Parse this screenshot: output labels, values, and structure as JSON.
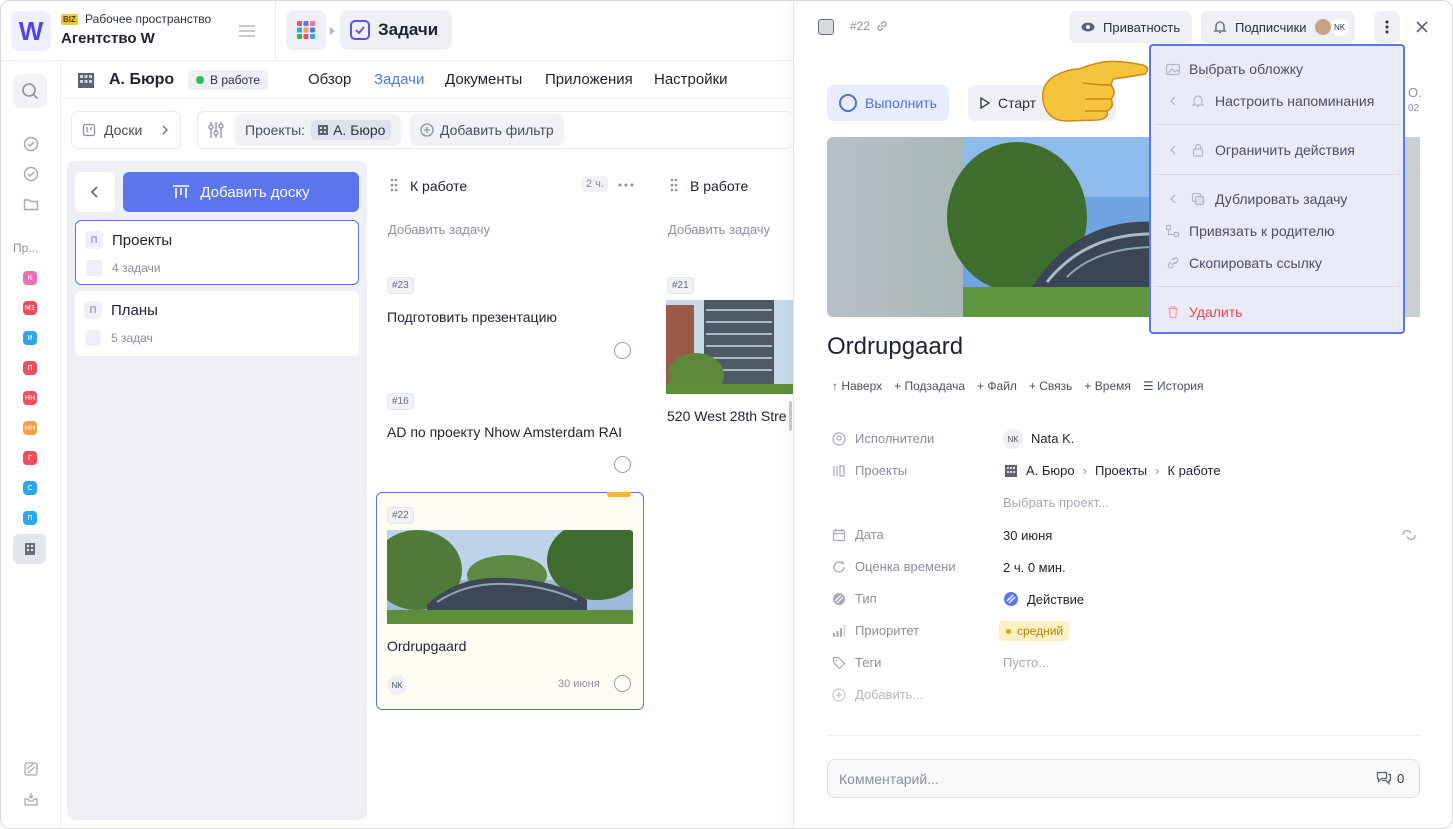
{
  "workspace": {
    "tag": "BIZ",
    "subtitle": "Рабочее пространство",
    "name": "Агентство W",
    "logo_letter": "W"
  },
  "app_tab": {
    "label": "Задачи"
  },
  "rail": {
    "section_label": "Пр...",
    "items": [
      {
        "letter": "К",
        "color": "#f06fb4"
      },
      {
        "letter": "М1",
        "color": "#f04e5e"
      },
      {
        "letter": "И",
        "color": "#2ba7f0"
      },
      {
        "letter": "П",
        "color": "#f04e5e"
      },
      {
        "letter": "НН",
        "color": "#f04e5e"
      },
      {
        "letter": "НН",
        "color": "#f5a144"
      },
      {
        "letter": "Г",
        "color": "#f04e5e"
      },
      {
        "letter": "С",
        "color": "#2ba7f0"
      },
      {
        "letter": "П",
        "color": "#2ba7f0"
      }
    ]
  },
  "project": {
    "title": "А. Бюро",
    "status": "В работе",
    "nav": [
      "Обзор",
      "Задачи",
      "Документы",
      "Приложения",
      "Настройки"
    ],
    "active_nav": "Задачи"
  },
  "filters": {
    "boards_label": "Доски",
    "projects_label": "Проекты:",
    "project_chip": "А. Бюро",
    "add_filter": "Добавить фильтр"
  },
  "boards": {
    "add_label": "Добавить доску",
    "items": [
      {
        "letter": "П",
        "name": "Проекты",
        "count": "4 задачи"
      },
      {
        "letter": "П",
        "name": "Планы",
        "count": "5 задач"
      }
    ]
  },
  "columns": [
    {
      "title": "К работе",
      "badge": "2 ч.",
      "add_task": "Добавить задачу",
      "cards": [
        {
          "num": "#23",
          "title": "Подготовить презентацию"
        },
        {
          "num": "#16",
          "title": "AD по проекту Nhow Amsterdam RAI"
        },
        {
          "num": "#22",
          "title": "Ordrupgaard",
          "assignee": "NK",
          "date": "30 июня"
        }
      ]
    },
    {
      "title": "В работе",
      "add_task": "Добавить задачу",
      "cards": [
        {
          "num": "#21",
          "title": "520 West 28th Stre"
        }
      ]
    }
  ],
  "panel": {
    "task_num": "#22",
    "privacy": "Приватность",
    "subscribers": "Подписчики",
    "subscriber_initials": "NK",
    "complete": "Выполнить",
    "start": "Старт",
    "right_clip_top": "О.",
    "right_clip_bottom": "02",
    "title": "Ordrupgaard",
    "actions": [
      "Наверх",
      "Подзадача",
      "Файл",
      "Связь",
      "Время",
      "История"
    ],
    "fields": {
      "assignees_label": "Исполнители",
      "assignee_initials": "NK",
      "assignee_name": "Nata K.",
      "projects_label": "Проекты",
      "path": [
        "А. Бюро",
        "Проекты",
        "К работе"
      ],
      "choose_project": "Выбрать проект...",
      "date_label": "Дата",
      "date_value": "30 июня",
      "estimate_label": "Оценка времени",
      "estimate_value": "2 ч. 0 мин.",
      "type_label": "Тип",
      "type_value": "Действие",
      "priority_label": "Приоритет",
      "priority_value": "средний",
      "tags_label": "Теги",
      "tags_value": "Пусто...",
      "add_label": "Добавить..."
    },
    "comment_placeholder": "Комментарий...",
    "comment_count": "0"
  },
  "menu": {
    "items": [
      {
        "label": "Выбрать обложку",
        "icon": "cover-icon"
      },
      {
        "label": "Настроить напоминания",
        "icon": "bell-icon",
        "submenu": true
      },
      {
        "label": "Ограничить действия",
        "icon": "lock-icon",
        "submenu": true
      },
      {
        "label": "Дублировать задачу",
        "icon": "duplicate-icon",
        "submenu": true
      },
      {
        "label": "Привязать к родителю",
        "icon": "link-parent-icon"
      },
      {
        "label": "Скопировать ссылку",
        "icon": "link-icon"
      },
      {
        "label": "Удалить",
        "icon": "trash-icon",
        "danger": true
      }
    ]
  },
  "colors": {
    "accent": "#5b75ec",
    "danger": "#e5484d",
    "priority_bg": "#fdf1c4"
  }
}
